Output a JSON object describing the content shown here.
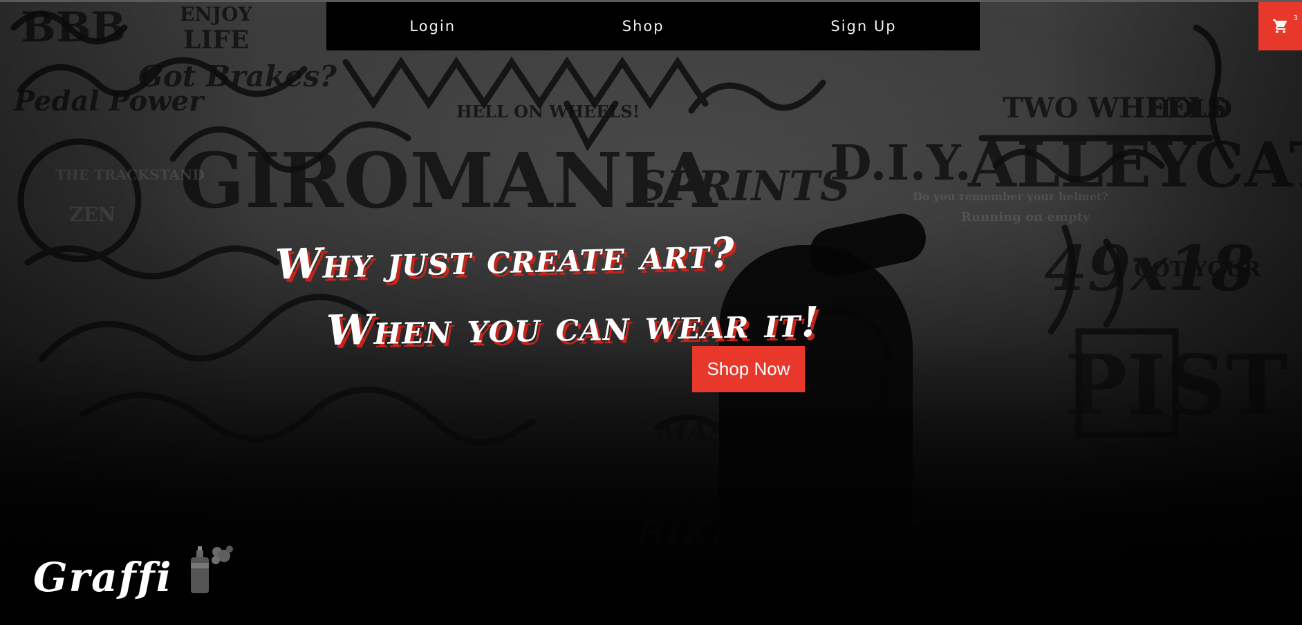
{
  "nav": {
    "links": [
      {
        "label": "Login"
      },
      {
        "label": "Shop"
      },
      {
        "label": "Sign Up"
      }
    ]
  },
  "cart": {
    "icon": "shopping-cart-icon",
    "count": "3"
  },
  "hero": {
    "headline_line1": "Why just create art?",
    "headline_line2": "When you can wear it!",
    "cta_label": "Shop Now"
  },
  "brand": {
    "logo_text": "Graffi",
    "logo_icon": "spray-can-icon"
  },
  "colors": {
    "accent": "#e8382b",
    "nav_background": "#000000",
    "text": "#ffffff",
    "headline_shadow": "#c3241b"
  }
}
